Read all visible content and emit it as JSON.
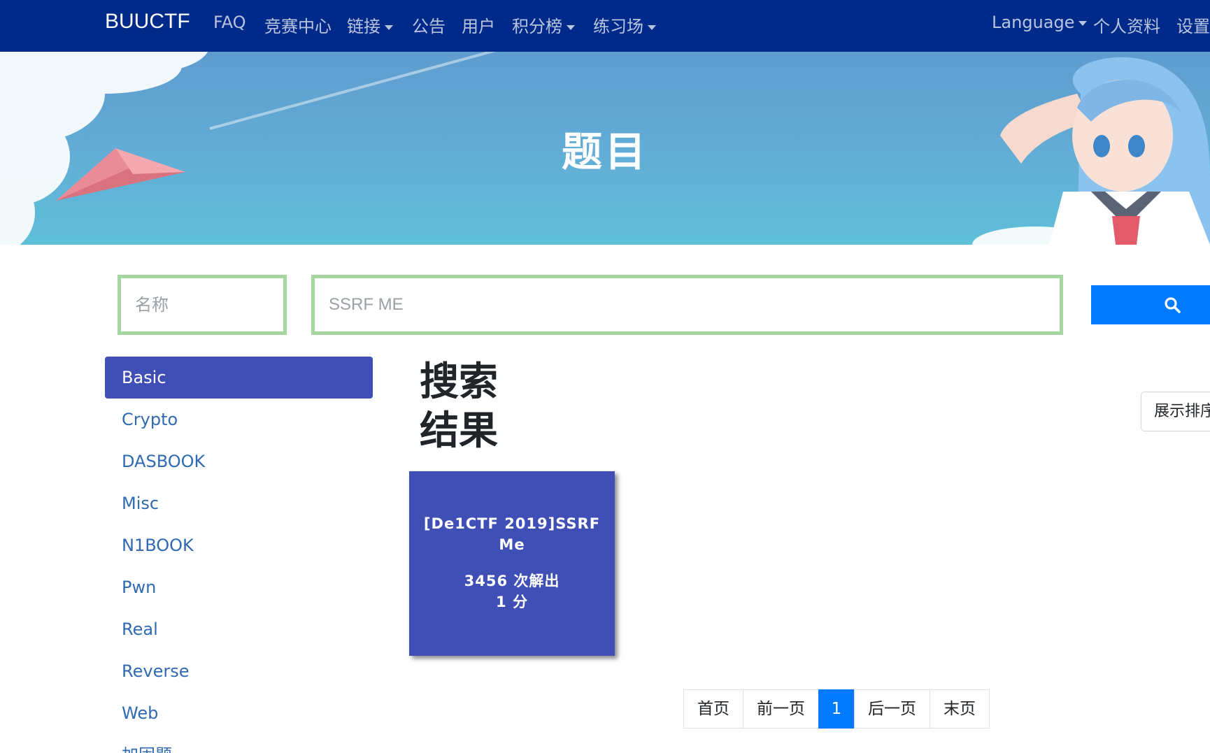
{
  "navbar": {
    "brand": "BUUCTF",
    "items": [
      {
        "label": "FAQ",
        "dropdown": false
      },
      {
        "label": "竞赛中心",
        "dropdown": false
      },
      {
        "label": "链接",
        "dropdown": true
      },
      {
        "label": "公告",
        "dropdown": false
      },
      {
        "label": "用户",
        "dropdown": false
      },
      {
        "label": "积分榜",
        "dropdown": true
      },
      {
        "label": "练习场",
        "dropdown": true
      }
    ],
    "right_items": [
      {
        "label": "Language",
        "dropdown": true
      },
      {
        "label": "个人资料",
        "dropdown": false
      },
      {
        "label": "设置",
        "dropdown": false
      }
    ]
  },
  "hero": {
    "title": "题目"
  },
  "search": {
    "name_placeholder": "名称",
    "name_value": "",
    "query_placeholder": "SSRF ME",
    "query_value": "",
    "button_icon": "search-icon"
  },
  "sidebar": {
    "categories": [
      {
        "label": "Basic",
        "active": true
      },
      {
        "label": "Crypto",
        "active": false
      },
      {
        "label": "DASBOOK",
        "active": false
      },
      {
        "label": "Misc",
        "active": false
      },
      {
        "label": "N1BOOK",
        "active": false
      },
      {
        "label": "Pwn",
        "active": false
      },
      {
        "label": "Real",
        "active": false
      },
      {
        "label": "Reverse",
        "active": false
      },
      {
        "label": "Web",
        "active": false
      },
      {
        "label": "加固题",
        "active": false
      }
    ]
  },
  "results": {
    "title": "搜索结果",
    "sort_button": "展示排序",
    "challenges": [
      {
        "name": "[De1CTF 2019]SSRF Me",
        "solves": "3456 次解出",
        "points": "1 分"
      }
    ]
  },
  "pagination": {
    "first": "首页",
    "prev": "前一页",
    "current": "1",
    "next": "后一页",
    "last": "末页"
  },
  "colors": {
    "navbar": "#002a8a",
    "accent": "#3f4fb5",
    "primary": "#007bff",
    "input_border": "#a7d7a0",
    "link": "#2f6ab3"
  }
}
